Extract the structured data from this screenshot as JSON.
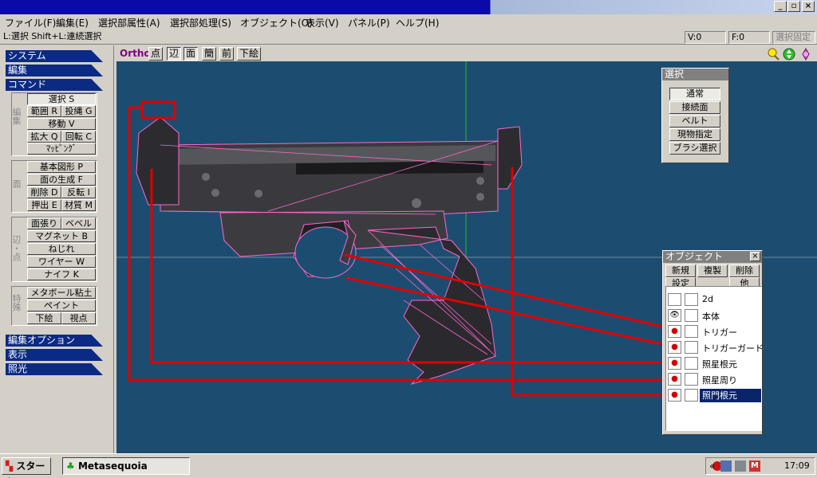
{
  "menu": [
    "ファイル(F)",
    "編集(E)",
    "選択部属性(A)",
    "選択部処理(S)",
    "オブジェクト(O)",
    "表示(V)",
    "パネル(P)",
    "ヘルプ(H)"
  ],
  "status": {
    "hint": "L:選択  Shift+L:連続選択",
    "v": "V:0",
    "f": "F:0",
    "fix": "選択固定"
  },
  "sidebar": {
    "system": "システム",
    "edit": "編集",
    "command": "コマンド",
    "group_edit_label": "編集",
    "group_face_label": "面",
    "group_edge_label": "辺・点",
    "group_special_label": "特殊",
    "select": "選択 S",
    "range": "範囲 R",
    "lasso": "投縄 G",
    "move": "移動 V",
    "scale": "拡大 Q",
    "rotate": "回転 C",
    "mapping": "ﾏｯﾋﾟﾝｸﾞ",
    "basic_shape": "基本図形 P",
    "face_gen": "面の生成 F",
    "delete": "削除 D",
    "invert": "反転 I",
    "extrude": "押出 E",
    "material": "材質 M",
    "face_bevel": "面張り",
    "bevel": "ベベル",
    "magnet": "マグネット B",
    "twist": "ねじれ",
    "wire": "ワイヤー W",
    "knife": "ナイフ K",
    "metaball": "メタボール粘土",
    "paint": "ペイント",
    "underlay": "下絵",
    "viewpoint": "視点",
    "edit_option": "編集オプション",
    "display": "表示",
    "light": "照光"
  },
  "viewbar": {
    "ortho": "Ortho",
    "point": "点",
    "edge": "辺",
    "face": "面",
    "simple": "簡",
    "front": "前",
    "underlay": "下絵"
  },
  "select_panel": {
    "title": "選択",
    "normal": "通常",
    "adjacent": "接続面",
    "belt": "ベルト",
    "current": "現物指定",
    "brush": "ブラシ選択"
  },
  "object_panel": {
    "title": "オブジェクト",
    "close": "×",
    "new": "新規",
    "duplicate": "複製",
    "delete": "削除",
    "settings": "設定",
    "other": "他",
    "objects": [
      {
        "name": "2d",
        "visible": ""
      },
      {
        "name": "本体",
        "visible": "👁"
      },
      {
        "name": "トリガー",
        "visible": "●"
      },
      {
        "name": "トリガーガード",
        "visible": "●"
      },
      {
        "name": "照星根元",
        "visible": "●"
      },
      {
        "name": "照星周り",
        "visible": "●"
      },
      {
        "name": "照門根元",
        "visible": "●"
      }
    ]
  },
  "taskbar": {
    "start": "スタート",
    "app": "Metasequoia",
    "clock": "17:09",
    "chevron": "«"
  },
  "colors": {
    "viewport": "#1c4d70",
    "wire": "#ff66cc",
    "annotation": "#e00000",
    "section": "#0a2a84"
  }
}
